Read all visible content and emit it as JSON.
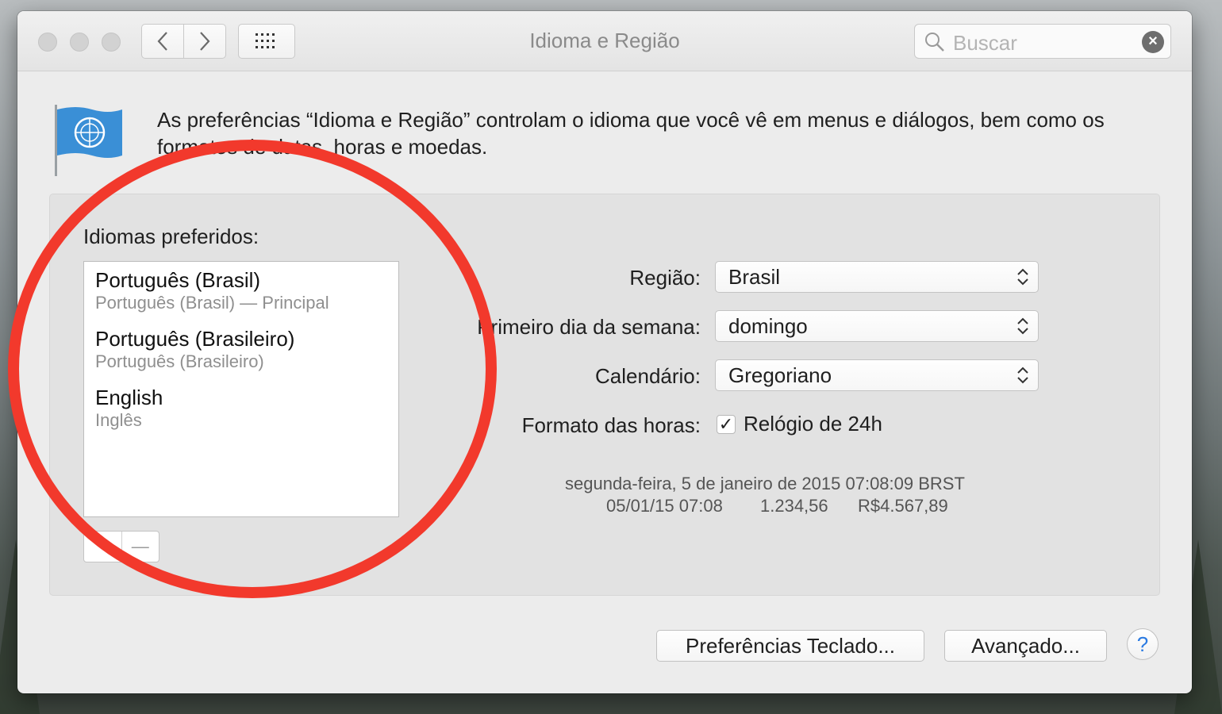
{
  "window": {
    "title": "Idioma e Região",
    "search_placeholder": "Buscar",
    "search_clear": "×"
  },
  "intro_text": "As preferências “Idioma e Região” controlam o idioma que você vê em menus e diálogos, bem como os formatos de datas, horas e moedas.",
  "preferred_languages": {
    "label": "Idiomas preferidos:",
    "items": [
      {
        "name": "Português (Brasil)",
        "subtitle": "Português (Brasil) — Principal"
      },
      {
        "name": "Português (Brasileiro)",
        "subtitle": "Português (Brasileiro)"
      },
      {
        "name": "English",
        "subtitle": "Inglês"
      }
    ],
    "remove_symbol": "—"
  },
  "settings": {
    "region_label": "Região:",
    "region_value": "Brasil",
    "first_day_label": "Primeiro dia da semana:",
    "first_day_value": "domingo",
    "calendar_label": "Calendário:",
    "calendar_value": "Gregoriano",
    "time_format_label": "Formato das horas:",
    "time_format_checked_mark": "✓",
    "time_format_option": "Relógio de 24h"
  },
  "sample": {
    "line1": "segunda-feira, 5 de janeiro de 2015 07:08:09 BRST",
    "short_date": "05/01/15 07:08",
    "number": "1.234,56",
    "currency": "R$4.567,89"
  },
  "footer": {
    "keyboard_prefs": "Preferências Teclado...",
    "advanced": "Avançado...",
    "help": "?"
  },
  "colors": {
    "annotation_circle": "#f2392c",
    "help_accent": "#2a7ae2"
  }
}
